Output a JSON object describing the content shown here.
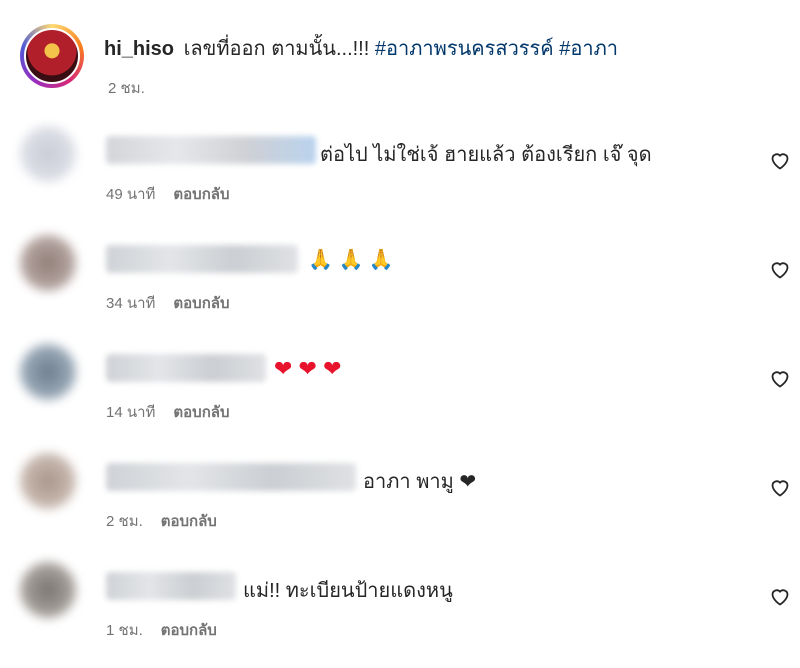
{
  "post": {
    "username": "hi_hiso",
    "text": " เลขที่ออก ตามนั้น...!!! ",
    "hashtags": [
      "#อาภาพรนครสวรรค์",
      "#อาภา"
    ],
    "time": "2 ชม."
  },
  "comments": [
    {
      "text": "ต่อไป ไม่ใช่เจ้ ฮายแล้ว ต้องเรียก เจ๊ จุด",
      "time": "49 นาที",
      "reply": "ตอบกลับ"
    },
    {
      "text": "🙏 🙏 🙏",
      "time": "34 นาที",
      "reply": "ตอบกลับ"
    },
    {
      "text": "❤ ❤ ❤",
      "time": "14 นาที",
      "reply": "ตอบกลับ"
    },
    {
      "text": "อาภา พามู ❤",
      "time": "2 ชม.",
      "reply": "ตอบกลับ"
    },
    {
      "text": "แม่!! ทะเบียนป้ายแดงหนู",
      "time": "1 ชม.",
      "reply": "ตอบกลับ"
    }
  ],
  "colors": {
    "hashtag": "#00376b",
    "muted": "#737373",
    "text": "#262626",
    "heart": "#e8122d"
  },
  "icons": {
    "like": "heart-outline-icon"
  }
}
